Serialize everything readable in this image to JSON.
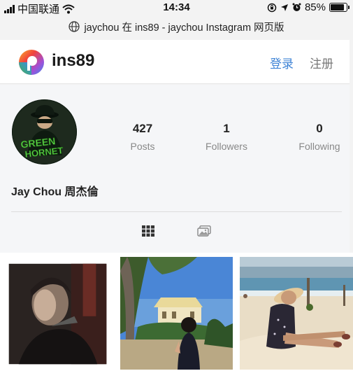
{
  "status_bar": {
    "carrier": "中国联通",
    "time": "14:34",
    "battery": "85%",
    "battery_level": 0.85
  },
  "url_bar": {
    "title": "jaychou 在 ins89 - jaychou Instagram 网页版",
    "icon": "globe-icon"
  },
  "header": {
    "brand": "ins89",
    "login_label": "登录",
    "signup_label": "注册",
    "logo_colors": [
      "#f2433b",
      "#f7b12a",
      "#3fb34f",
      "#3b8bf0",
      "#a14fd6"
    ]
  },
  "profile": {
    "avatar_text": "GREEN HORNET",
    "stats": [
      {
        "value": "427",
        "label": "Posts"
      },
      {
        "value": "1",
        "label": "Followers"
      },
      {
        "value": "0",
        "label": "Following"
      }
    ],
    "display_name": "Jay Chou 周杰倫",
    "tabs": [
      {
        "icon": "grid-icon",
        "active": true
      },
      {
        "icon": "gallery-icon",
        "active": false
      }
    ]
  },
  "grid": {
    "tiles": [
      "dark-portrait-painting",
      "girl-in-front-of-house",
      "woman-on-beach"
    ]
  },
  "colors": {
    "accent": "#3f84d6",
    "background": "#f5f6f8"
  }
}
